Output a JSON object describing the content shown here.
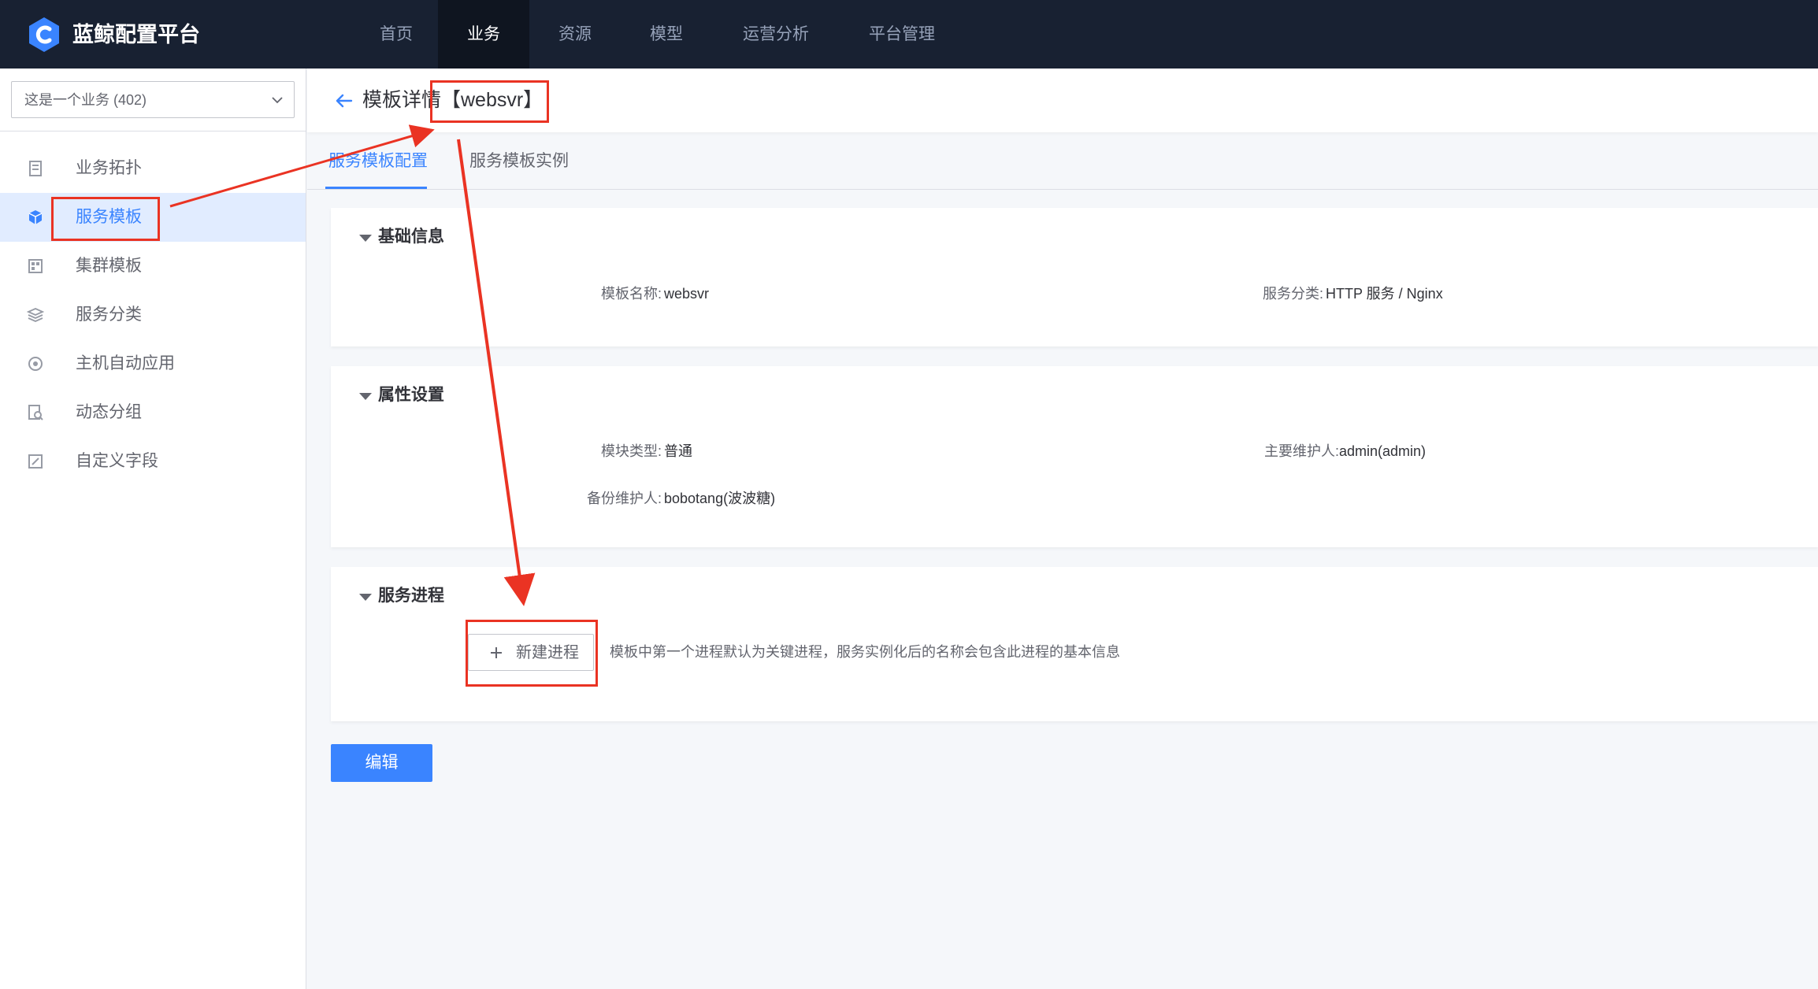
{
  "app": {
    "brand": "蓝鲸配置平台",
    "logo_icon": "bk-cmdb-logo-icon"
  },
  "topnav": {
    "items": [
      {
        "label": "首页",
        "active": false
      },
      {
        "label": "业务",
        "active": true
      },
      {
        "label": "资源",
        "active": false
      },
      {
        "label": "模型",
        "active": false
      },
      {
        "label": "运营分析",
        "active": false
      },
      {
        "label": "平台管理",
        "active": false
      }
    ]
  },
  "sidebar": {
    "business_select": {
      "value": "这是一个业务 (402)"
    },
    "items": [
      {
        "label": "业务拓扑",
        "icon": "topology-icon",
        "active": false
      },
      {
        "label": "服务模板",
        "icon": "service-template-icon",
        "active": true
      },
      {
        "label": "集群模板",
        "icon": "cluster-template-icon",
        "active": false
      },
      {
        "label": "服务分类",
        "icon": "service-category-icon",
        "active": false
      },
      {
        "label": "主机自动应用",
        "icon": "host-auto-apply-icon",
        "active": false
      },
      {
        "label": "动态分组",
        "icon": "dynamic-group-icon",
        "active": false
      },
      {
        "label": "自定义字段",
        "icon": "custom-field-icon",
        "active": false
      }
    ]
  },
  "header": {
    "title": "模板详情【websvr】"
  },
  "tabs": [
    {
      "label": "服务模板配置",
      "active": true
    },
    {
      "label": "服务模板实例",
      "active": false
    }
  ],
  "basic_info": {
    "title": "基础信息",
    "template_name_label": "模板名称:",
    "template_name_value": "websvr",
    "service_category_label": "服务分类:",
    "service_category_value": "HTTP 服务 / Nginx"
  },
  "attributes": {
    "title": "属性设置",
    "module_type_label": "模块类型:",
    "module_type_value": "普通",
    "maintainer_label": "主要维护人:",
    "maintainer_value": "admin(admin)",
    "backup_maintainer_label": "备份维护人:",
    "backup_maintainer_value": "bobotang(波波糖)"
  },
  "process": {
    "title": "服务进程",
    "add_button_label": "新建进程",
    "hint": "模板中第一个进程默认为关键进程，服务实例化后的名称会包含此进程的基本信息"
  },
  "actions": {
    "edit_label": "编辑"
  },
  "colors": {
    "topbar": "#182132",
    "primary": "#3a84ff",
    "annotation": "#ea3323"
  }
}
